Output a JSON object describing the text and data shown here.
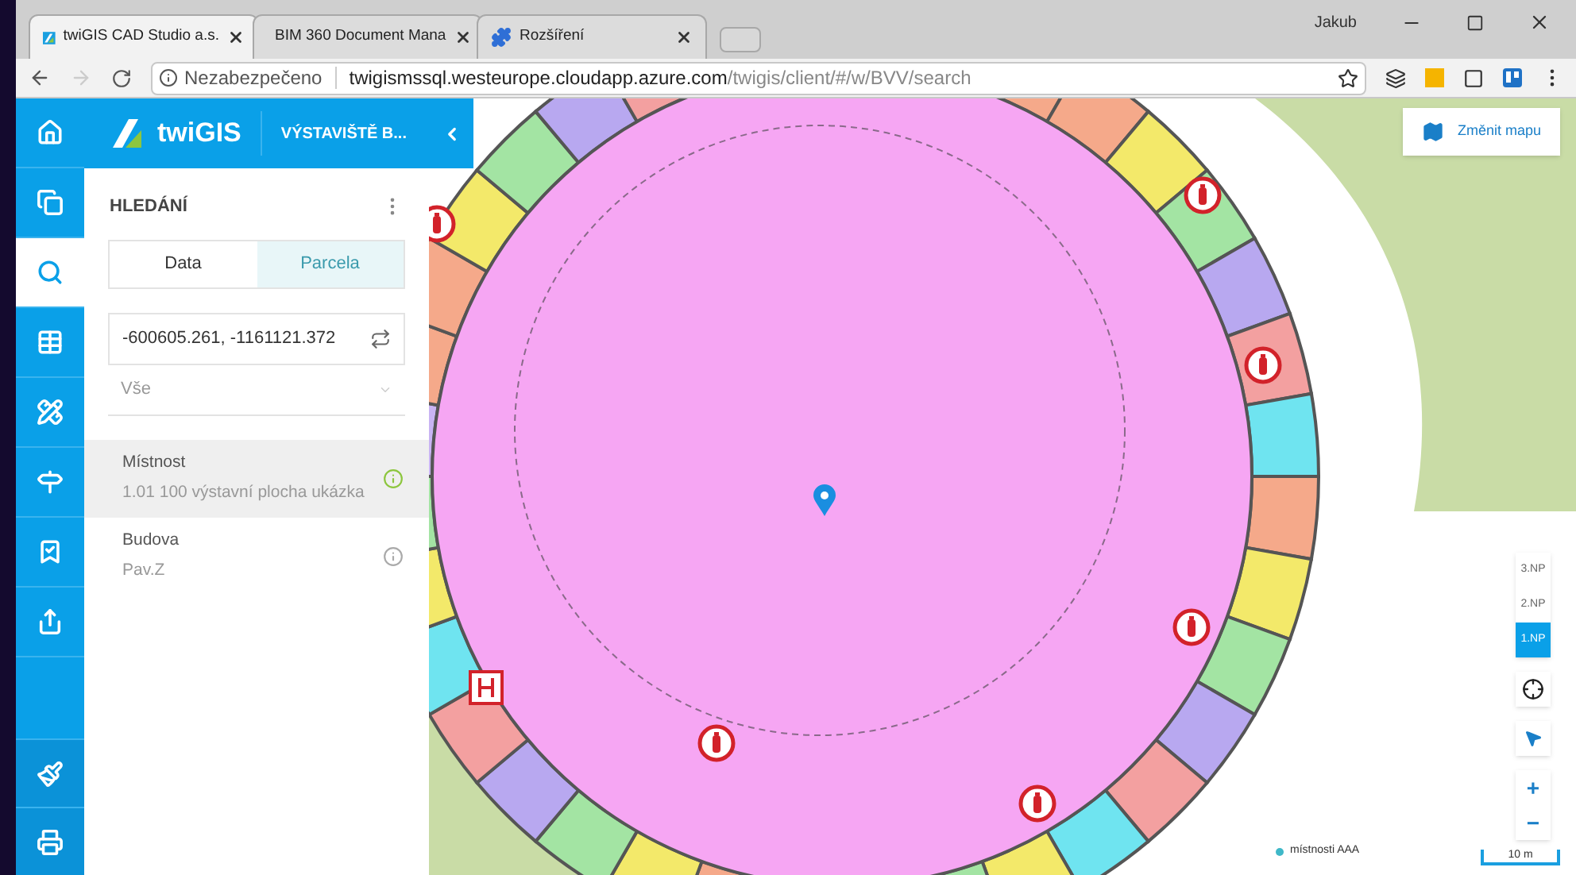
{
  "browser": {
    "tabs": [
      {
        "title": "twiGIS CAD Studio a.s.",
        "selected": true
      },
      {
        "title": "BIM 360 Document Mana",
        "selected": false
      },
      {
        "title": "Rozšíření",
        "selected": false
      }
    ],
    "profile": "Jakub",
    "security": "Nezabezpečeno",
    "url_host": "twigismssql.westeurope.cloudapp.azure.com",
    "url_path": "/twigis/client/#/w/BVV/search"
  },
  "app": {
    "logo": "twiGIS",
    "title": "VÝSTAVIŠTĚ B...",
    "nav": [
      {
        "kind": "home",
        "selected": false
      },
      {
        "kind": "layers",
        "selected": false
      },
      {
        "kind": "search",
        "selected": true
      },
      {
        "kind": "table",
        "selected": false
      },
      {
        "kind": "tools",
        "selected": false
      },
      {
        "kind": "signpost",
        "selected": false
      },
      {
        "kind": "bookmark",
        "selected": false
      },
      {
        "kind": "share",
        "selected": false
      }
    ],
    "nav_bottom": [
      {
        "kind": "brush"
      },
      {
        "kind": "print"
      }
    ],
    "panel": {
      "title": "HLEDÁNÍ",
      "tabs": [
        {
          "label": "Data",
          "selected": true
        },
        {
          "label": "Parcela",
          "selected": false
        }
      ],
      "search_value": "-600605.261, -1161121.372",
      "filter": "Vše",
      "results": [
        {
          "title": "Místnost",
          "subtitle": "1.01 100 výstavní plocha ukázka",
          "selected": true
        },
        {
          "title": "Budova",
          "subtitle": "Pav.Z",
          "selected": false
        }
      ]
    },
    "map": {
      "change_map": "Změnit mapu",
      "floors": [
        {
          "label": "3.NP",
          "selected": false
        },
        {
          "label": "2.NP",
          "selected": false
        },
        {
          "label": "1.NP",
          "selected": true
        }
      ],
      "zoom_in": "+",
      "zoom_out": "−",
      "scale": "10 m",
      "legend": [
        {
          "label": "místnosti AAA",
          "color": "#3fb8c8"
        }
      ]
    }
  }
}
